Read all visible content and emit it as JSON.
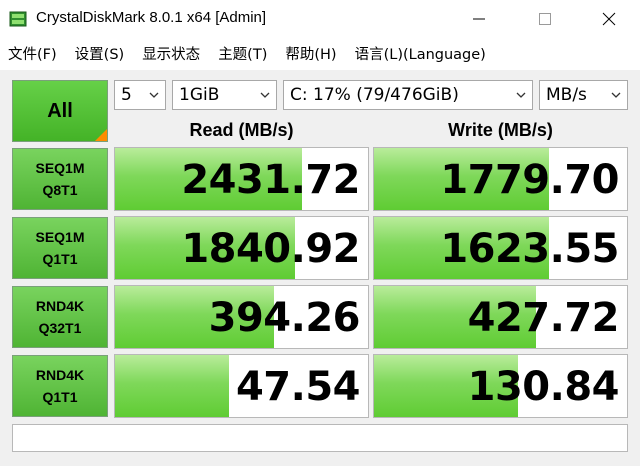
{
  "window": {
    "title": "CrystalDiskMark 8.0.1 x64 [Admin]"
  },
  "menu": [
    "文件(F)",
    "设置(S)",
    "显示状态",
    "主题(T)",
    "帮助(H)",
    "语言(L)(Language)"
  ],
  "controls": {
    "all_label": "All",
    "count": "5",
    "size": "1GiB",
    "drive": "C: 17% (79/476GiB)",
    "unit": "MB/s"
  },
  "headers": {
    "read": "Read (MB/s)",
    "write": "Write (MB/s)"
  },
  "rows": [
    {
      "line1": "SEQ1M",
      "line2": "Q8T1",
      "read": "2431.72",
      "write": "1779.70",
      "read_fill": 0.74,
      "write_fill": 0.69
    },
    {
      "line1": "SEQ1M",
      "line2": "Q1T1",
      "read": "1840.92",
      "write": "1623.55",
      "read_fill": 0.71,
      "write_fill": 0.69
    },
    {
      "line1": "RND4K",
      "line2": "Q32T1",
      "read": "394.26",
      "write": "427.72",
      "read_fill": 0.63,
      "write_fill": 0.64
    },
    {
      "line1": "RND4K",
      "line2": "Q1T1",
      "read": "47.54",
      "write": "130.84",
      "read_fill": 0.45,
      "write_fill": 0.57
    }
  ],
  "comment": "",
  "colors": {
    "accent_green": "#5fcc33",
    "corner_orange": "#ff8c00"
  }
}
